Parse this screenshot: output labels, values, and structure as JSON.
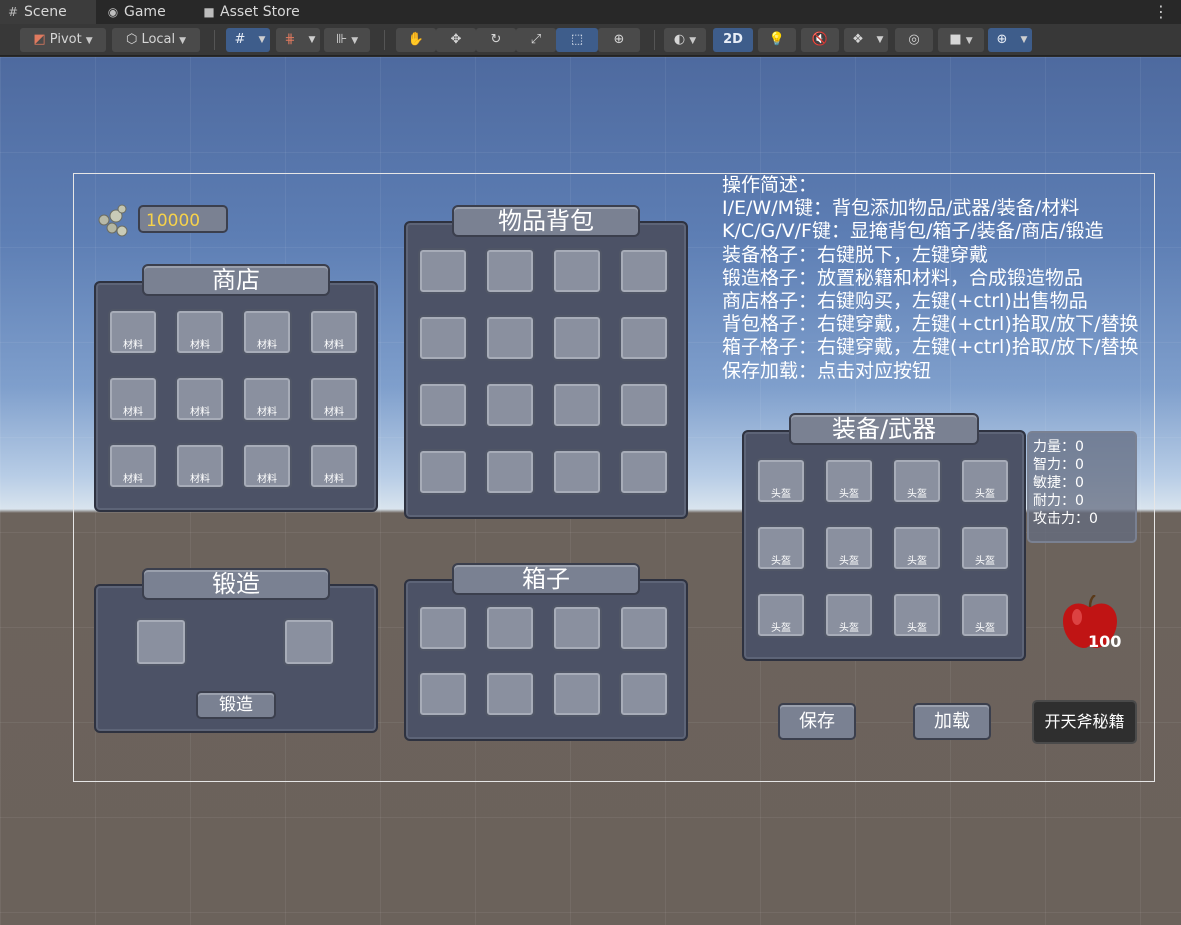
{
  "tabs": [
    {
      "label": "Scene",
      "icon": "scene-grid-icon"
    },
    {
      "label": "Game",
      "icon": "gamepad-icon"
    },
    {
      "label": "Asset Store",
      "icon": "shopping-bag-icon"
    }
  ],
  "toolbar": {
    "pivot_label": "Pivot",
    "local_label": "Local",
    "mode_2d_label": "2D",
    "accent_color": "#3e5d8b"
  },
  "gold": {
    "amount": "10000",
    "color": "#f7d24a"
  },
  "shop": {
    "title": "商店",
    "slots": [
      "材料",
      "材料",
      "材料",
      "材料",
      "材料",
      "材料",
      "材料",
      "材料",
      "材料",
      "材料",
      "材料",
      "材料"
    ]
  },
  "inventory": {
    "title": "物品背包"
  },
  "forge": {
    "title": "锻造",
    "button_label": "锻造"
  },
  "chest": {
    "title": "箱子"
  },
  "equipment": {
    "title": "装备/武器",
    "slots": [
      "头盔",
      "头盔",
      "头盔",
      "头盔",
      "头盔",
      "头盔",
      "头盔",
      "头盔",
      "头盔",
      "头盔",
      "头盔",
      "头盔"
    ]
  },
  "instructions": [
    "操作简述：",
    "I/E/W/M键：背包添加物品/武器/装备/材料",
    "K/C/G/V/F键：显掩背包/箱子/装备/商店/锻造",
    "装备格子：右键脱下，左键穿戴",
    "锻造格子：放置秘籍和材料，合成锻造物品",
    "商店格子：右键购买，左键(+ctrl)出售物品",
    "背包格子：右键穿戴，左键(+ctrl)拾取/放下/替换",
    "箱子格子：右键穿戴，左键(+ctrl)拾取/放下/替换",
    "保存加载：点击对应按钮"
  ],
  "stats": [
    "力量：0",
    "智力：0",
    "敏捷：0",
    "耐力：0",
    "攻击力：0"
  ],
  "apple": {
    "count": "100"
  },
  "buttons": {
    "save": "保存",
    "load": "加载",
    "secret": "开天斧秘籍"
  }
}
